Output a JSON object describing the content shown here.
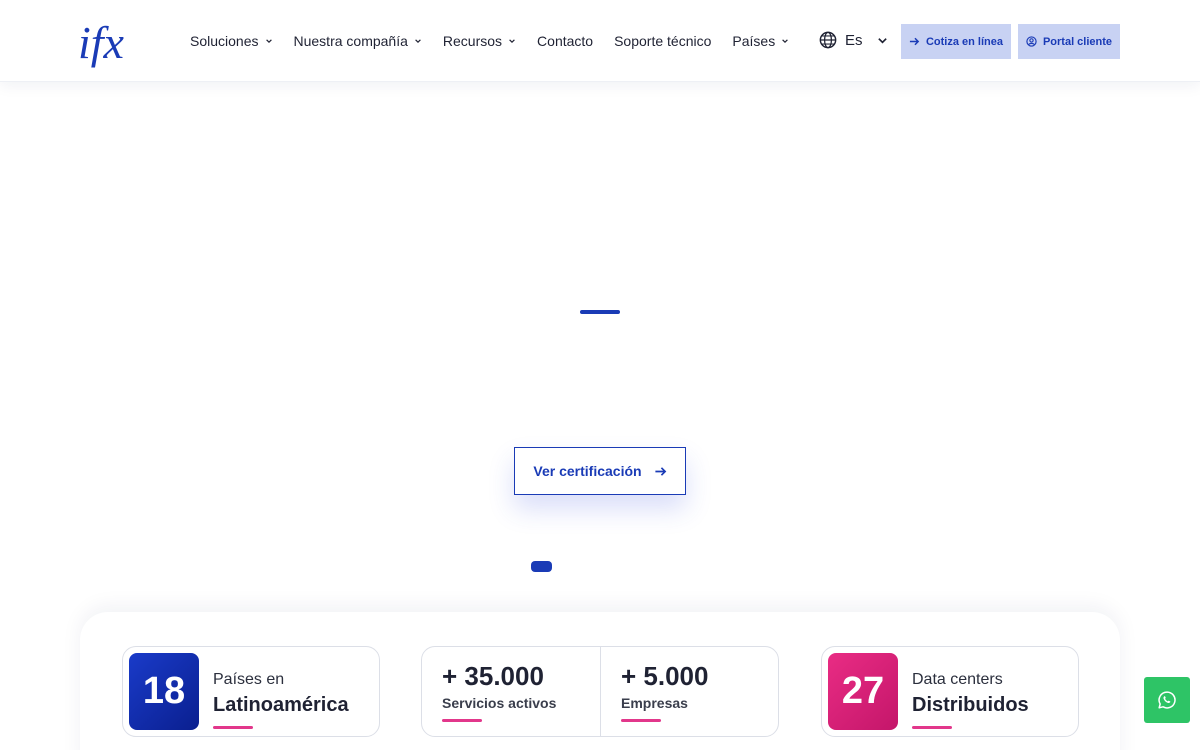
{
  "brand": {
    "logo_text": "ifx",
    "color": "#1a3bb6"
  },
  "nav": {
    "items": [
      {
        "label": "Soluciones",
        "dropdown": true
      },
      {
        "label": "Nuestra compañía",
        "dropdown": true
      },
      {
        "label": "Recursos",
        "dropdown": true
      },
      {
        "label": "Contacto",
        "dropdown": false
      },
      {
        "label": "Soporte técnico",
        "dropdown": false
      },
      {
        "label": "Países",
        "dropdown": true
      }
    ]
  },
  "language": {
    "label": "Es",
    "icon": "globe-icon"
  },
  "header_buttons": {
    "cotiza": "Cotiza en línea",
    "portal": "Portal cliente"
  },
  "hero": {
    "cta_label": "Ver certificación"
  },
  "stats": {
    "countries": {
      "number": "18",
      "line1": "Países en",
      "line2": "Latinoamérica"
    },
    "services": {
      "number": "+ 35.000",
      "label": "Servicios activos"
    },
    "companies": {
      "number": "+ 5.000",
      "label": "Empresas"
    },
    "datacenters": {
      "number": "27",
      "line1": "Data centers",
      "line2": "Distribuidos"
    }
  },
  "colors": {
    "accent": "#1a3bb6",
    "pink": "#e2378b",
    "whatsapp": "#2ec466",
    "button_bg": "#c8d2f3"
  }
}
